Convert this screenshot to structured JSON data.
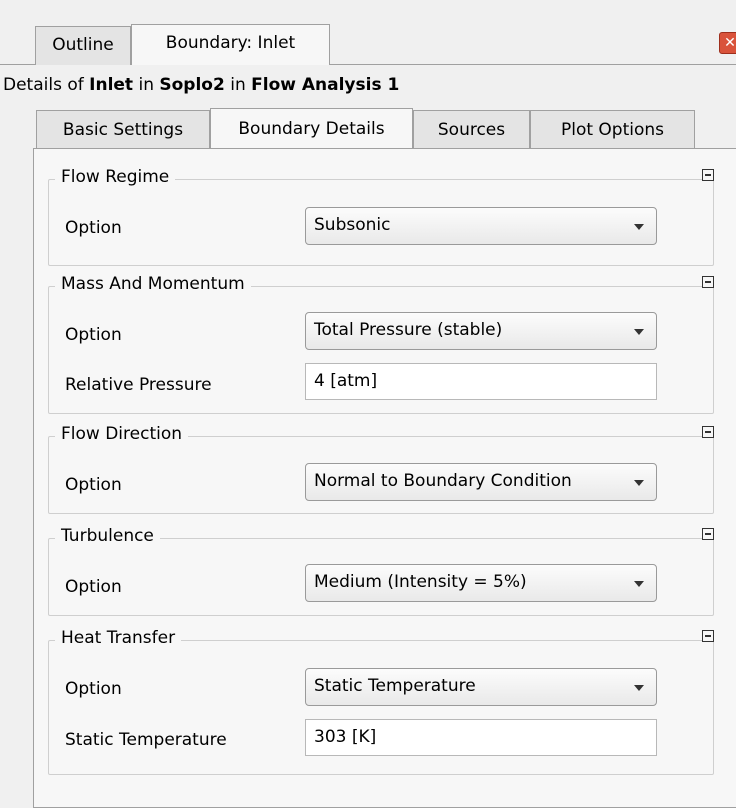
{
  "window": {
    "tabs": [
      {
        "label": "Outline"
      },
      {
        "label": "Boundary: Inlet"
      }
    ]
  },
  "details": {
    "prefix": "Details of ",
    "object": "Inlet",
    "in1": " in ",
    "domain": "Soplo2",
    "in2": " in ",
    "analysis": "Flow Analysis 1"
  },
  "inner_tabs": [
    {
      "label": "Basic Settings"
    },
    {
      "label": "Boundary Details"
    },
    {
      "label": "Sources"
    },
    {
      "label": "Plot Options"
    }
  ],
  "groups": {
    "flow_regime": {
      "title": "Flow Regime",
      "option_label": "Option",
      "option_value": "Subsonic"
    },
    "mass_momentum": {
      "title": "Mass And Momentum",
      "option_label": "Option",
      "option_value": "Total Pressure (stable)",
      "pressure_label": "Relative Pressure",
      "pressure_value": "4 [atm]"
    },
    "flow_direction": {
      "title": "Flow Direction",
      "option_label": "Option",
      "option_value": "Normal to Boundary Condition"
    },
    "turbulence": {
      "title": "Turbulence",
      "option_label": "Option",
      "option_value": "Medium (Intensity = 5%)"
    },
    "heat_transfer": {
      "title": "Heat Transfer",
      "option_label": "Option",
      "option_value": "Static Temperature",
      "temp_label": "Static Temperature",
      "temp_value": "303 [K]"
    }
  },
  "icons": {
    "close": "close-icon",
    "collapse": "collapse-icon",
    "dropdown": "chevron-down-icon"
  },
  "colors": {
    "close_red": "#d9533b",
    "border": "#a0a0a0"
  }
}
